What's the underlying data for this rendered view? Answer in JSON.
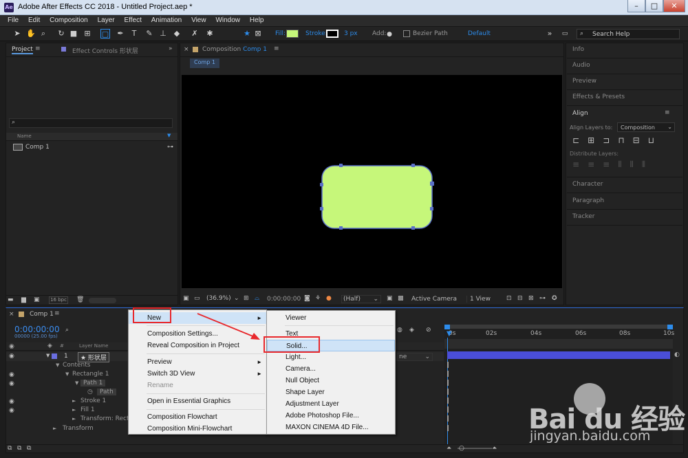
{
  "window": {
    "title": "Adobe After Effects CC 2018 - Untitled Project.aep *",
    "app_badge": "Ae",
    "minimize": "–",
    "maximize": "□",
    "close": "✕"
  },
  "menu": [
    "File",
    "Edit",
    "Composition",
    "Layer",
    "Effect",
    "Animation",
    "View",
    "Window",
    "Help"
  ],
  "toolbar": {
    "fill_label": "Fill:",
    "stroke_label": "Stroke:",
    "stroke_width": "3 px",
    "add_label": "Add:",
    "bezier_label": "Bezier Path",
    "workspace": "Default",
    "search_placeholder": "Search Help",
    "fill_color": "#c6f77a"
  },
  "project_panel": {
    "tab_project": "Project",
    "tab_effects": "Effect Controls 形状层",
    "col_name": "Name",
    "items": [
      "Comp 1"
    ],
    "bpc": "16 bpc",
    "search_placeholder": ""
  },
  "comp_panel": {
    "tab": "Composition",
    "tab_comp": "Comp 1",
    "breadcrumb": "Comp 1",
    "zoom": "(36.9%)",
    "timecode": "0:00:00:00",
    "resolution": "(Half)",
    "camera": "Active Camera",
    "views": "1 View",
    "shape_color": "#c6f77a",
    "shape_stroke": "#5a70c8"
  },
  "right_panel": {
    "sections": [
      "Info",
      "Audio",
      "Preview",
      "Effects & Presets"
    ],
    "align_title": "Align",
    "align_to_label": "Align Layers to:",
    "align_to_value": "Composition",
    "distribute_label": "Distribute Layers:",
    "lower_sections": [
      "Character",
      "Paragraph",
      "Tracker"
    ]
  },
  "timeline": {
    "tab": "Comp 1",
    "timecode": "0:00:00:00",
    "fps": "00000 (25.00 fps)",
    "col_layer_name": "Layer Name",
    "col_num": "#",
    "ruler": [
      "0s",
      "02s",
      "04s",
      "06s",
      "08s",
      "10s"
    ],
    "layer_num": "1",
    "layer_name": "★ 形状层",
    "mode": "ne",
    "tree": [
      "Contents",
      "Rectangle 1",
      "Path 1",
      "Path",
      "Stroke 1",
      "Fill 1",
      "Transform: Rect",
      "Transform"
    ],
    "bar_color": "#4a4ed8"
  },
  "context_menu": {
    "items": [
      "New",
      "Composition Settings...",
      "Reveal Composition in Project",
      "Preview",
      "Switch 3D View",
      "Rename",
      "Open in Essential Graphics",
      "Composition Flowchart",
      "Composition Mini-Flowchart"
    ]
  },
  "submenu": {
    "items": [
      "Viewer",
      "Text",
      "Solid...",
      "Light...",
      "Camera...",
      "Null Object",
      "Shape Layer",
      "Adjustment Layer",
      "Adobe Photoshop File...",
      "MAXON CINEMA 4D File..."
    ]
  },
  "watermark": {
    "brand": "Bai du 经验",
    "url": "jingyan.baidu.com"
  },
  "annotation_color": "#e8282c"
}
